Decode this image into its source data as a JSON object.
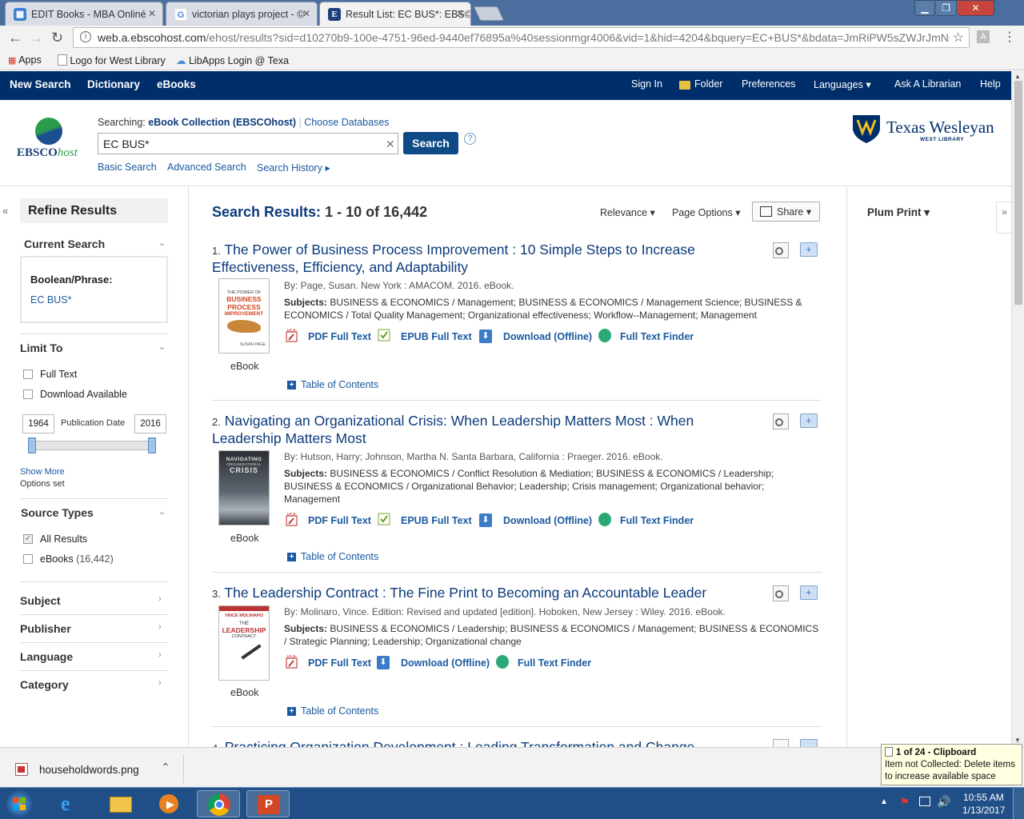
{
  "browser": {
    "tabs": [
      {
        "title": "EDIT Books - MBA Onliné",
        "icon": "edit-books-icon"
      },
      {
        "title": "victorian plays project - ©",
        "icon": "google-icon"
      },
      {
        "title": "Result List: EC BUS*: EBS©",
        "icon": "ebsco-e-icon"
      }
    ],
    "url_host": "web.a.ebscohost.com",
    "url_path": "/ehost/results?sid=d10270b9-100e-4751-96ed-9440ef76895a%40sessionmgr4006&vid=1&hid=4204&bquery=EC+BUS*&bdata=JmRiPW5sZWJrJmNsá",
    "bookmarks": {
      "apps": "Apps",
      "west_library": "Logo for West Library",
      "libapps": "LibApps Login @ Texa"
    }
  },
  "ebsco_nav": {
    "left": [
      "New Search",
      "Dictionary",
      "eBooks"
    ],
    "right": [
      "Sign In",
      "Folder",
      "Preferences",
      "Languages ▾",
      "Ask A Librarian",
      "Help"
    ]
  },
  "search": {
    "logo_text_1": "EBSCO",
    "logo_text_2": "host",
    "searching_label": "Searching:",
    "database": "eBook Collection (EBSCOhost)",
    "choose_db": "Choose Databases",
    "query": "EC BUS*",
    "button": "Search",
    "basic": "Basic Search",
    "advanced": "Advanced Search",
    "history": "Search History ▸",
    "help": "?"
  },
  "institution": {
    "name": "Texas Wesleyan",
    "sub": "WEST LIBRARY"
  },
  "refine": {
    "title": "Refine Results",
    "current_search": "Current Search",
    "boolean_label": "Boolean/Phrase:",
    "boolean_value": "EC BUS*",
    "limit_to": "Limit To",
    "full_text": "Full Text",
    "download_available": "Download Available",
    "date_from": "1964",
    "date_label": "Publication Date",
    "date_to": "2016",
    "show_more": "Show More",
    "options_set": "Options set",
    "source_types": "Source Types",
    "all_results": "All Results",
    "ebooks": "eBooks",
    "ebooks_count": "(16,442)",
    "subject": "Subject",
    "publisher": "Publisher",
    "language": "Language",
    "category": "Category"
  },
  "results_header": {
    "label": "Search Results:",
    "range": "1 - 10 of 16,442",
    "relevance": "Relevance ▾",
    "page_options": "Page Options ▾",
    "share": "Share ▾"
  },
  "results": [
    {
      "num": "1.",
      "title": "The Power of Business Process Improvement : 10 Simple Steps to Increase Effectiveness, Efficiency, and Adaptability",
      "byline": "By: Page, Susan. New York : AMACOM. 2016. eBook.",
      "subjects_label": "Subjects:",
      "subjects": "BUSINESS & ECONOMICS / Management; BUSINESS & ECONOMICS / Management Science; BUSINESS & ECONOMICS / Total Quality Management; Organizational effectiveness; Workflow--Management; Management",
      "type": "eBook",
      "links": [
        "PDF Full Text",
        "EPUB Full Text",
        "Download (Offline)",
        "Full Text Finder"
      ],
      "toc": "Table of Contents",
      "cover": {
        "line1": "THE POWER OF",
        "line2": "BUSINESS",
        "line3": "PROCESS",
        "line4": "IMPROVEMENT",
        "author": "SUSAN PAGE"
      }
    },
    {
      "num": "2.",
      "title": "Navigating an Organizational Crisis: When Leadership Matters Most : When Leadership Matters Most",
      "byline": "By: Hutson, Harry; Johnson, Martha N. Santa Barbara, California : Praeger. 2016. eBook.",
      "subjects_label": "Subjects:",
      "subjects": "BUSINESS & ECONOMICS / Conflict Resolution & Mediation; BUSINESS & ECONOMICS / Leadership; BUSINESS & ECONOMICS / Organizational Behavior; Leadership; Crisis management; Organizational behavior; Management",
      "type": "eBook",
      "links": [
        "PDF Full Text",
        "EPUB Full Text",
        "Download (Offline)",
        "Full Text Finder"
      ],
      "toc": "Table of Contents",
      "cover": {
        "line1": "NAVIGATING",
        "line2": "ORGANIZATIONAL",
        "line3": "CRISIS"
      }
    },
    {
      "num": "3.",
      "title": "The Leadership Contract : The Fine Print to Becoming an Accountable Leader",
      "byline": "By: Molinaro, Vince. Edition: Revised and updated [edition]. Hoboken, New Jersey : Wiley. 2016. eBook.",
      "subjects_label": "Subjects:",
      "subjects": "BUSINESS & ECONOMICS / Leadership; BUSINESS & ECONOMICS / Management; BUSINESS & ECONOMICS / Strategic Planning; Leadership; Organizational change",
      "type": "eBook",
      "links": [
        "PDF Full Text",
        "Download (Offline)",
        "Full Text Finder"
      ],
      "toc": "Table of Contents",
      "cover": {
        "line1": "VINCE MOLINARO",
        "line2": "THE",
        "line3": "LEADERSHIP",
        "line4": "CONTRACT"
      }
    },
    {
      "num": "4.",
      "title": "Practicing Organization Development : Leading Transformation and Change"
    }
  ],
  "right_panel": {
    "plum_print": "Plum Print ▾"
  },
  "download_bar": {
    "file": "householdwords.png"
  },
  "clipboard": {
    "title": "1 of 24 - Clipboard",
    "line1": "Item not Collected: Delete items",
    "line2": "to increase available space"
  },
  "taskbar": {
    "time": "10:55 AM",
    "date": "1/13/2017"
  },
  "colors": {
    "nav_bg": "#002e6a",
    "link": "#1a5aa0",
    "title": "#0b3a7a",
    "search_button": "#0e4a85",
    "taskbar": "#1f4f86"
  }
}
